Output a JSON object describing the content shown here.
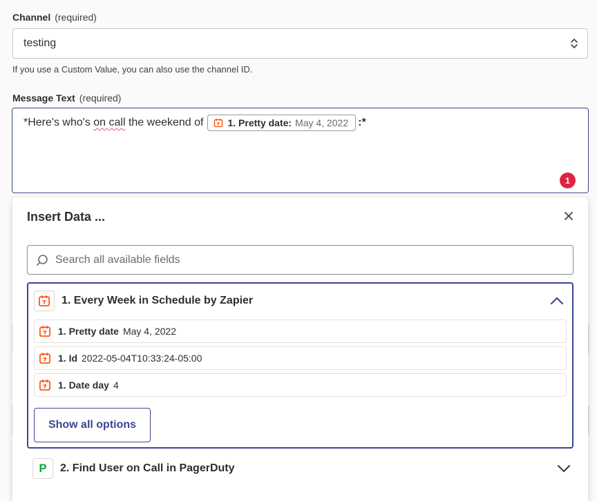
{
  "channel": {
    "label": "Channel",
    "required": "(required)",
    "value": "testing",
    "hint": "If you use a Custom Value, you can also use the channel ID."
  },
  "message": {
    "label": "Message Text",
    "required": "(required)",
    "text_before": "*Here's who's ",
    "text_squiggle": "on call",
    "text_middle": " the weekend of",
    "pill_label": "1. Pretty date:",
    "pill_value": "May 4, 2022",
    "text_after": ":*",
    "badge": "1"
  },
  "insert_data": {
    "title": "Insert Data ...",
    "search_placeholder": "Search all available fields",
    "step1": {
      "title": "1. Every Week in Schedule by Zapier",
      "options": [
        {
          "label": "1. Pretty date",
          "value": "May 4, 2022"
        },
        {
          "label": "1. Id",
          "value": "2022-05-04T10:33:24-05:00"
        },
        {
          "label": "1. Date day",
          "value": "4"
        }
      ],
      "show_all": "Show all options"
    },
    "step2": {
      "title": "2. Find User on Call in PagerDuty",
      "icon_letter": "P"
    }
  },
  "colors": {
    "accent": "#3d4592",
    "badge": "#e0243f",
    "zapier_orange": "#ff4a00",
    "pagerduty_green": "#06ac38"
  }
}
